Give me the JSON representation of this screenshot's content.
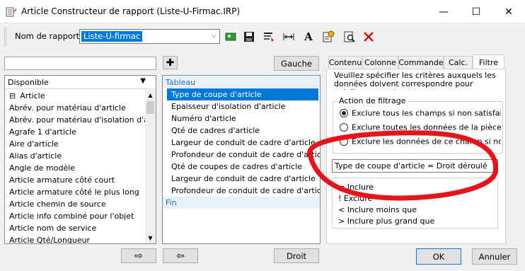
{
  "window": {
    "title": "Article Constructeur de rapport (Liste-U-Firmac.IRP)",
    "minimize": "—",
    "maximize": "☐",
    "close": "✕"
  },
  "toolbar": {
    "report_name_label": "Nom de rapport",
    "report_name_value": "Liste-U-firmac",
    "font_letter": "A"
  },
  "left": {
    "search_value": "",
    "dropdown_value": "Disponible",
    "items": [
      "Article",
      "Abrév. pour matériau d'article",
      "Abrév. pour matériau d'isolation d'arti...",
      "Agrafe 1 d'article",
      "Aire d'article",
      "Alias d'article",
      "Angle de modèle",
      "Article armature côté court",
      "Article armature côté le plus long",
      "Article chemin de source",
      "Article info combiné pour l'objet",
      "Article nom de service",
      "Article Qté/Longueur"
    ],
    "expander": "⊟"
  },
  "middle": {
    "gauche_label": "Gauche",
    "droit_label": "Droit",
    "items": [
      "Tableau",
      "Type de coupe d'article",
      "Epaisseur d'isolation d'article",
      "Numéro d'article",
      "Qté de cadres d'article",
      "Largeur de conduit de cadre d'article",
      "Profondeur de conduit de cadre d'article",
      "Qté de coupes de cadres d'article",
      "Largeur de conduit de cadre d'article",
      "Profondeur de conduit de cadre d'article",
      "Fin"
    ],
    "selected_index": 1
  },
  "right": {
    "tabs": [
      "Contenu",
      "Colonne",
      "Commande",
      "Calc.",
      "Filtre"
    ],
    "active_tab": "Filtre",
    "instructions": "Veuillez spécifier les critères auxquels les données doivent correspondre pour qu'elles apparaissent",
    "group_label": "Action de filtrage",
    "radios": [
      "Exclure tous les champs si non satisfaits",
      "Exclure toutes les données de la pièce bru",
      "Exclure les données de ce champ si non sa"
    ],
    "selected_radio": 0,
    "filter_value": "Type de coupe d'article = Droit déroulé",
    "operators": [
      "= Inclure",
      "! Exclure",
      "< Inclure moins que",
      "> Inclure plus grand que"
    ]
  },
  "footer": {
    "right_arrow": "⇨",
    "left_arrow": "⇦",
    "ok": "OK",
    "cancel": "Annuler"
  },
  "annotation_color": "#e8141b"
}
